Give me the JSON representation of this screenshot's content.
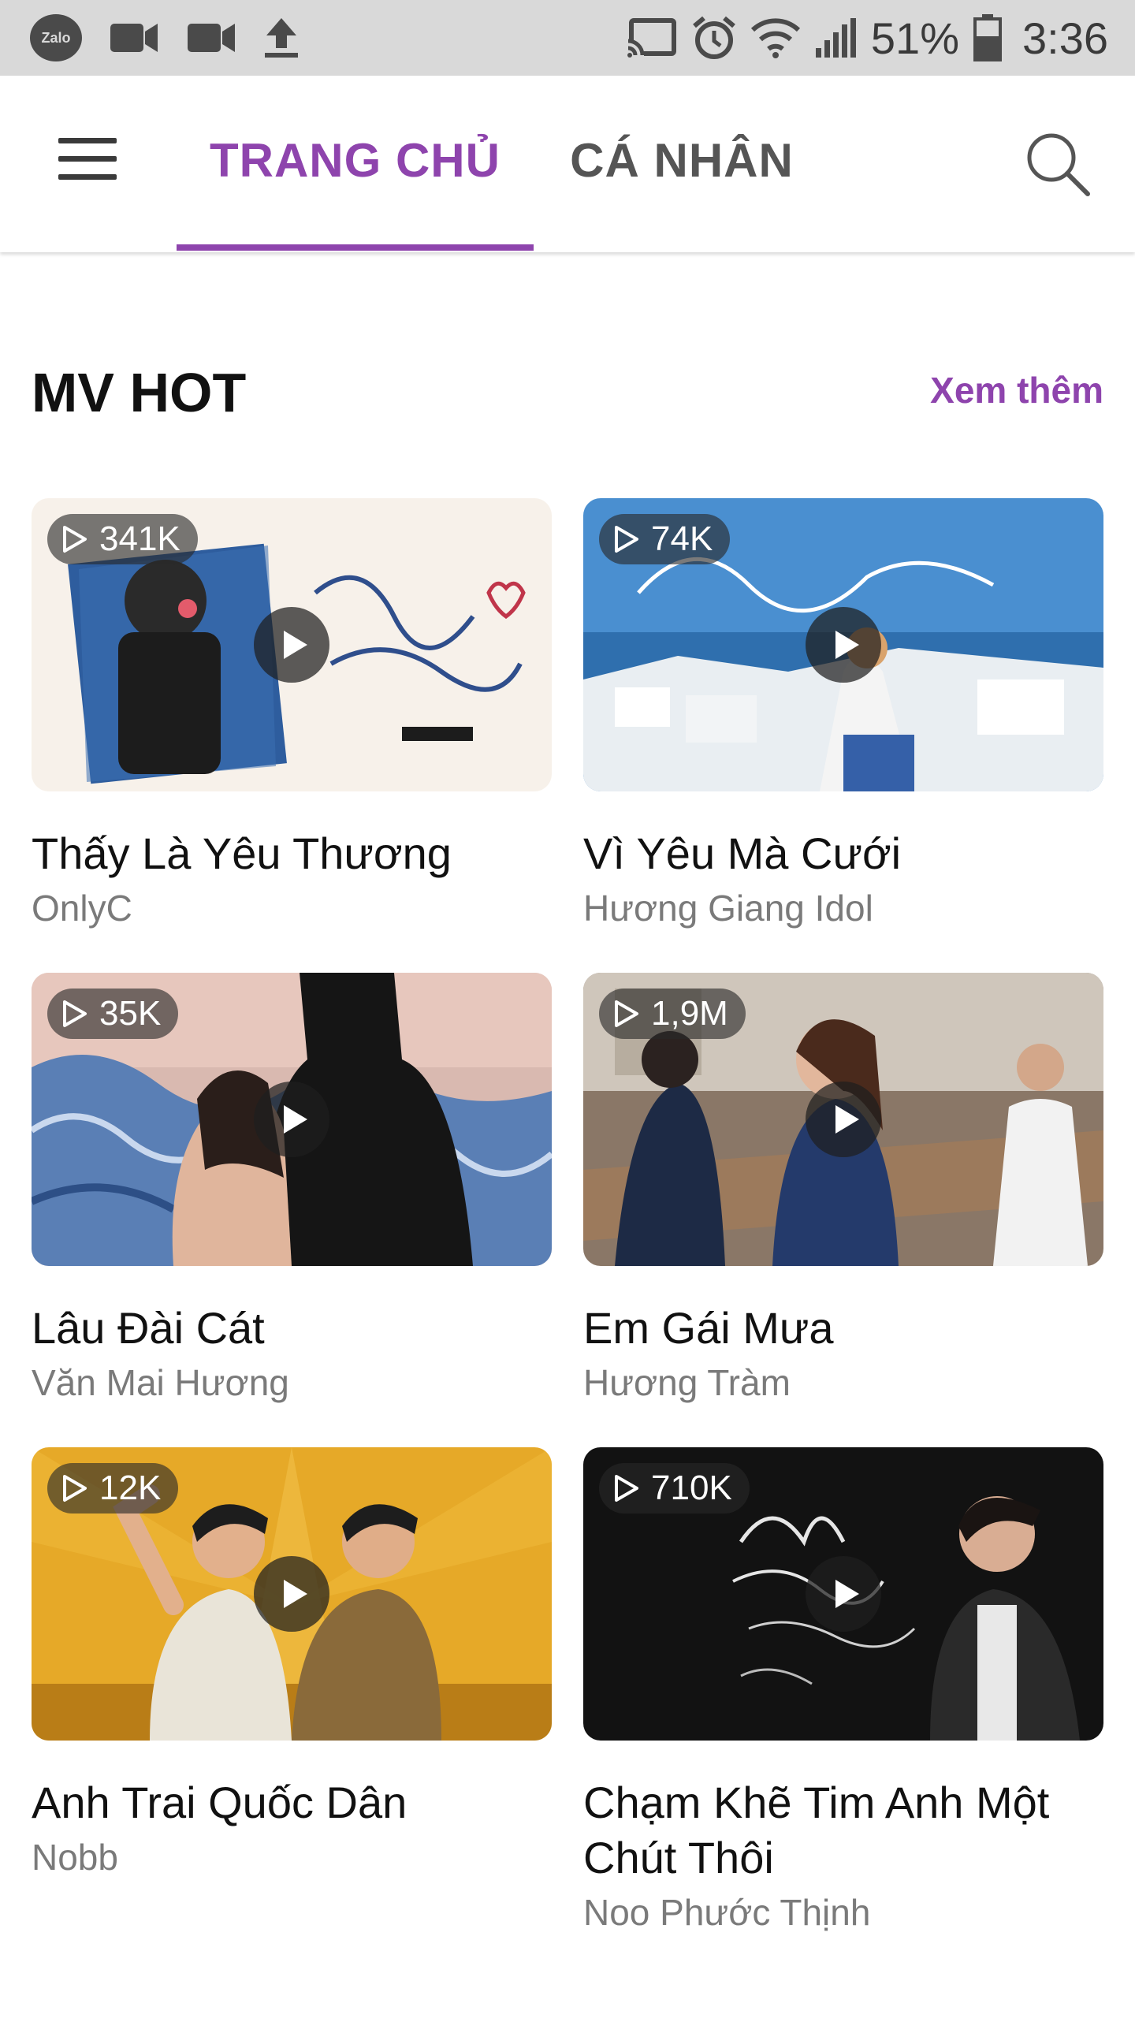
{
  "status_bar": {
    "left_icons": [
      "zalo-app-icon",
      "video-camera-icon",
      "video-camera-icon",
      "upload-icon"
    ],
    "zalo_label": "Zalo",
    "right_icons": [
      "cast-icon",
      "alarm-icon",
      "wifi-icon",
      "signal-icon",
      "battery-icon"
    ],
    "battery_percent": "51%",
    "time": "3:36"
  },
  "app_bar": {
    "tabs": [
      {
        "label": "TRANG CHỦ",
        "active": true
      },
      {
        "label": "CÁ NHÂN",
        "active": false
      }
    ]
  },
  "section": {
    "title": "MV HOT",
    "see_more": "Xem thêm"
  },
  "videos": [
    {
      "title": "Thấy Là Yêu Thương",
      "artist": "OnlyC",
      "views": "341K"
    },
    {
      "title": "Vì Yêu Mà Cưới",
      "artist": "Hương Giang Idol",
      "views": "74K"
    },
    {
      "title": "Lâu Đài Cát",
      "artist": "Văn Mai Hương",
      "views": "35K"
    },
    {
      "title": "Em Gái Mưa",
      "artist": "Hương Tràm",
      "views": "1,9M"
    },
    {
      "title": "Anh Trai Quốc Dân",
      "artist": "Nobb",
      "views": "12K"
    },
    {
      "title": "Chạm Khẽ Tim Anh Một Chút Thôi",
      "artist": "Noo Phước Thịnh",
      "views": "710K"
    }
  ],
  "colors": {
    "accent": "#8e44ad",
    "status_bar_bg": "#d9d9d9",
    "secondary_text": "#7a7a7a"
  }
}
